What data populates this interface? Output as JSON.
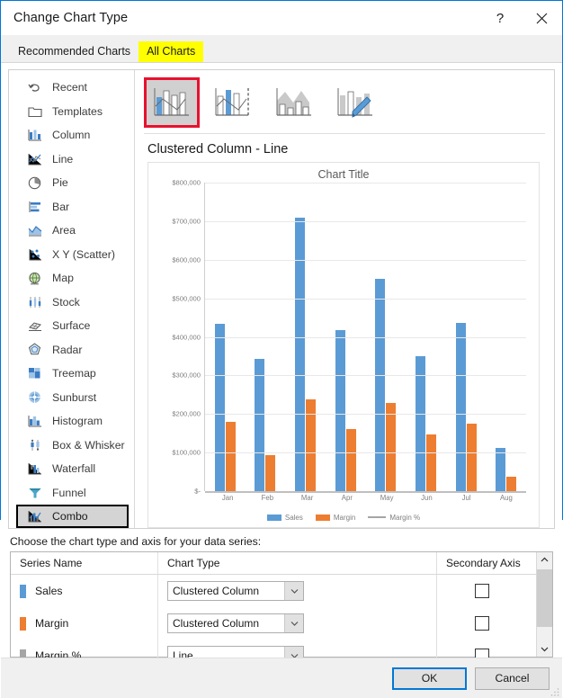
{
  "window": {
    "title": "Change Chart Type",
    "help_label": "?",
    "close_label": "✕"
  },
  "tabs": [
    {
      "label": "Recommended Charts",
      "selected": false
    },
    {
      "label": "All Charts",
      "selected": true
    }
  ],
  "sidebar": {
    "items": [
      {
        "label": "Recent",
        "icon": "recent-icon",
        "selected": false
      },
      {
        "label": "Templates",
        "icon": "templates-icon",
        "selected": false
      },
      {
        "label": "Column",
        "icon": "column-icon",
        "selected": false
      },
      {
        "label": "Line",
        "icon": "line-icon",
        "selected": false
      },
      {
        "label": "Pie",
        "icon": "pie-icon",
        "selected": false
      },
      {
        "label": "Bar",
        "icon": "bar-icon",
        "selected": false
      },
      {
        "label": "Area",
        "icon": "area-icon",
        "selected": false
      },
      {
        "label": "X Y (Scatter)",
        "icon": "scatter-icon",
        "selected": false
      },
      {
        "label": "Map",
        "icon": "map-icon",
        "selected": false
      },
      {
        "label": "Stock",
        "icon": "stock-icon",
        "selected": false
      },
      {
        "label": "Surface",
        "icon": "surface-icon",
        "selected": false
      },
      {
        "label": "Radar",
        "icon": "radar-icon",
        "selected": false
      },
      {
        "label": "Treemap",
        "icon": "treemap-icon",
        "selected": false
      },
      {
        "label": "Sunburst",
        "icon": "sunburst-icon",
        "selected": false
      },
      {
        "label": "Histogram",
        "icon": "histogram-icon",
        "selected": false
      },
      {
        "label": "Box & Whisker",
        "icon": "box-whisker-icon",
        "selected": false
      },
      {
        "label": "Waterfall",
        "icon": "waterfall-icon",
        "selected": false
      },
      {
        "label": "Funnel",
        "icon": "funnel-icon",
        "selected": false
      },
      {
        "label": "Combo",
        "icon": "combo-icon",
        "selected": true
      }
    ]
  },
  "thumbnails": [
    {
      "name": "clustered-column-line",
      "selected": true
    },
    {
      "name": "clustered-column-line-on-secondary-axis",
      "selected": false
    },
    {
      "name": "stacked-area-clustered-column",
      "selected": false
    },
    {
      "name": "custom-combination",
      "selected": false
    }
  ],
  "preview": {
    "heading": "Clustered Column - Line"
  },
  "series_section": {
    "instruction": "Choose the chart type and axis for your data series:",
    "headers": {
      "series_name": "Series Name",
      "chart_type": "Chart Type",
      "secondary_axis": "Secondary Axis"
    },
    "rows": [
      {
        "name": "Sales",
        "color": "#5b9bd5",
        "chart_type": "Clustered Column",
        "secondary_axis": false
      },
      {
        "name": "Margin",
        "color": "#ed7d31",
        "chart_type": "Clustered Column",
        "secondary_axis": false
      },
      {
        "name": "Margin %",
        "color": "#a5a5a5",
        "chart_type": "Line",
        "secondary_axis": false
      }
    ]
  },
  "footer": {
    "ok_label": "OK",
    "cancel_label": "Cancel"
  },
  "colors": {
    "accent": "#0078d7",
    "highlight": "#ffff00",
    "selection_red": "#e8112d",
    "sales": "#5b9bd5",
    "margin": "#ed7d31",
    "margin_pct": "#a5a5a5"
  },
  "chart_data": {
    "type": "bar",
    "title": "Chart Title",
    "xlabel": "",
    "ylabel": "",
    "categories": [
      "Jan",
      "Feb",
      "Mar",
      "Apr",
      "May",
      "Jun",
      "Jul",
      "Aug"
    ],
    "ylim": [
      0,
      800000
    ],
    "ytick_labels": [
      "$800,000",
      "$700,000",
      "$600,000",
      "$500,000",
      "$400,000",
      "$300,000",
      "$200,000",
      "$100,000",
      "$-"
    ],
    "ytick_values": [
      800000,
      700000,
      600000,
      500000,
      400000,
      300000,
      200000,
      100000,
      0
    ],
    "grid": true,
    "legend_position": "bottom",
    "series": [
      {
        "name": "Sales",
        "type": "column",
        "color": "#5b9bd5",
        "values": [
          435000,
          343000,
          708000,
          418000,
          551000,
          350000,
          436000,
          112000
        ]
      },
      {
        "name": "Margin",
        "type": "column",
        "color": "#ed7d31",
        "values": [
          180000,
          94000,
          238000,
          161000,
          228000,
          147000,
          174000,
          37000
        ]
      },
      {
        "name": "Margin %",
        "type": "line",
        "color": "#a5a5a5",
        "values": [
          0,
          0,
          0,
          0,
          0,
          0,
          0,
          0
        ]
      }
    ]
  }
}
